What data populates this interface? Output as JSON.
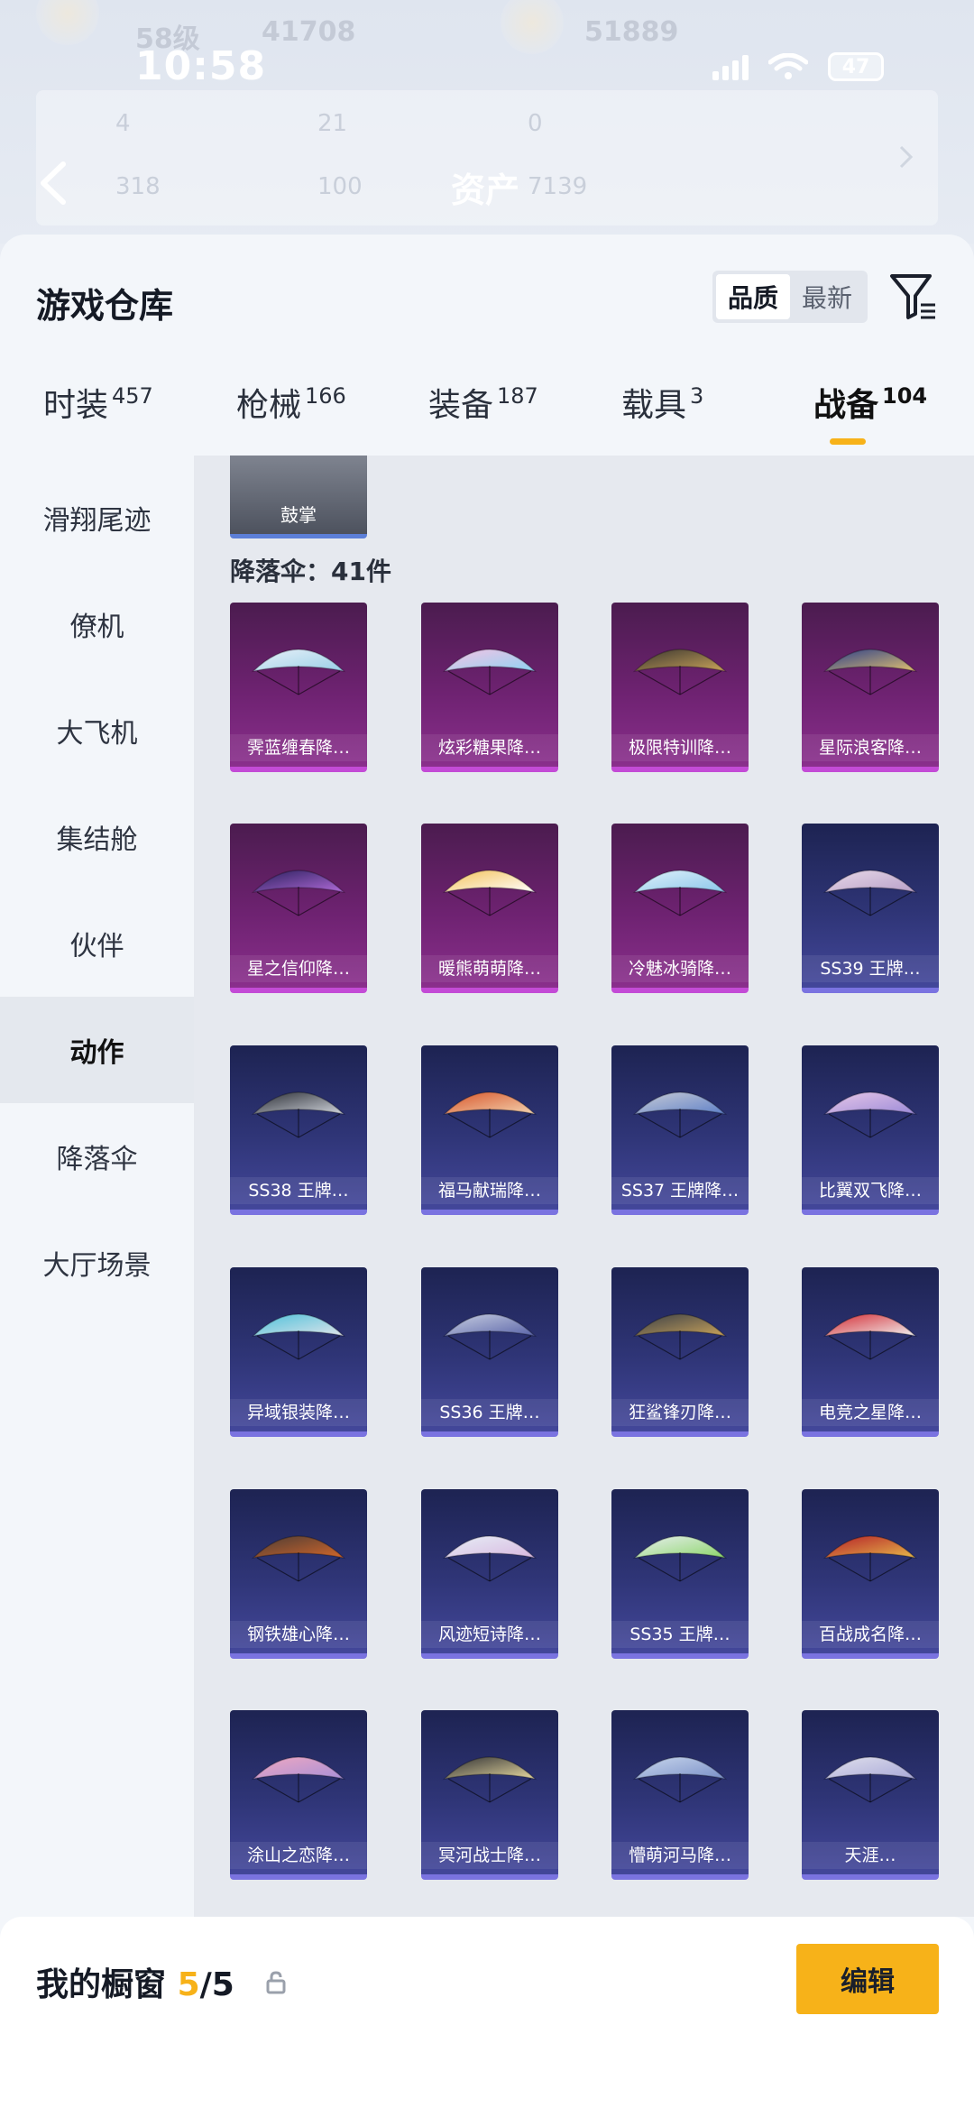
{
  "status_bar": {
    "time": "10:58",
    "battery": "47"
  },
  "background_header": {
    "left_level": "58级",
    "left_coins": "41708",
    "right_value": "51889",
    "stats_row1": [
      "4",
      "21",
      "0"
    ],
    "stats_row2": [
      "318",
      "100"
    ],
    "assets_label": "资产",
    "assets_value": "7139"
  },
  "sheet": {
    "title": "游戏仓库",
    "sort": {
      "quality": "品质",
      "newest": "最新"
    }
  },
  "tabs": [
    {
      "label": "时装",
      "count": "457"
    },
    {
      "label": "枪械",
      "count": "166"
    },
    {
      "label": "装备",
      "count": "187"
    },
    {
      "label": "载具",
      "count": "3"
    },
    {
      "label": "战备",
      "count": "104"
    }
  ],
  "sidebar": {
    "items": [
      {
        "label": "滑翔尾迹"
      },
      {
        "label": "僚机"
      },
      {
        "label": "大飞机"
      },
      {
        "label": "集结舱"
      },
      {
        "label": "伙伴"
      },
      {
        "label": "动作"
      },
      {
        "label": "降落伞"
      },
      {
        "label": "大厅场景"
      }
    ],
    "active_index": 5
  },
  "content": {
    "partial_item": "鼓掌",
    "section_label": "降落伞：41件",
    "items": [
      {
        "name": "霁蓝缠春降…",
        "rarity": "purple",
        "colors": [
          "#e8f0f8",
          "#9ad0e8"
        ]
      },
      {
        "name": "炫彩糖果降…",
        "rarity": "purple",
        "colors": [
          "#f6c2e4",
          "#8fd3f2"
        ]
      },
      {
        "name": "极限特训降…",
        "rarity": "purple",
        "colors": [
          "#3a3630",
          "#c9a35a"
        ]
      },
      {
        "name": "星际浪客降…",
        "rarity": "purple",
        "colors": [
          "#2a3d8a",
          "#e0c070"
        ]
      },
      {
        "name": "星之信仰降…",
        "rarity": "purple",
        "colors": [
          "#2a1f5c",
          "#b06ad8"
        ]
      },
      {
        "name": "暖熊萌萌降…",
        "rarity": "purple",
        "colors": [
          "#f3c25a",
          "#ffffff"
        ]
      },
      {
        "name": "冷魅冰骑降…",
        "rarity": "purple",
        "colors": [
          "#dff2fb",
          "#8bc6ea"
        ]
      },
      {
        "name": "SS39 王牌…",
        "rarity": "blue",
        "colors": [
          "#e7d8e8",
          "#b8a0c8"
        ]
      },
      {
        "name": "SS38 王牌…",
        "rarity": "blue",
        "colors": [
          "#2a2d34",
          "#d0d4dc"
        ]
      },
      {
        "name": "福马献瑞降…",
        "rarity": "blue",
        "colors": [
          "#d8552a",
          "#f2d3b0"
        ]
      },
      {
        "name": "SS37 王牌降…",
        "rarity": "blue",
        "colors": [
          "#c8ccd6",
          "#5f80c8"
        ]
      },
      {
        "name": "比翼双飞降…",
        "rarity": "blue",
        "colors": [
          "#e8c8e8",
          "#9b8ad8"
        ]
      },
      {
        "name": "异域银装降…",
        "rarity": "blue",
        "colors": [
          "#4cc0da",
          "#e0e4ea"
        ]
      },
      {
        "name": "SS36 王牌…",
        "rarity": "blue",
        "colors": [
          "#c8cfe2",
          "#5a64a8"
        ]
      },
      {
        "name": "狂鲨锋刃降…",
        "rarity": "blue",
        "colors": [
          "#3a3f47",
          "#c8a25a"
        ]
      },
      {
        "name": "电竞之星降…",
        "rarity": "blue",
        "colors": [
          "#d42a32",
          "#f0f0f0"
        ]
      },
      {
        "name": "钢铁雄心降…",
        "rarity": "blue",
        "colors": [
          "#4a3c36",
          "#d2662a"
        ]
      },
      {
        "name": "风迹短诗降…",
        "rarity": "blue",
        "colors": [
          "#e6eef6",
          "#d8b8e0"
        ]
      },
      {
        "name": "SS35 王牌…",
        "rarity": "blue",
        "colors": [
          "#e8eef0",
          "#8cd66a"
        ]
      },
      {
        "name": "百战成名降…",
        "rarity": "blue",
        "colors": [
          "#b41e28",
          "#e6b84a"
        ]
      },
      {
        "name": "涂山之恋降…",
        "rarity": "blue",
        "colors": [
          "#f0a8c0",
          "#a890d8"
        ]
      },
      {
        "name": "冥河战士降…",
        "rarity": "blue",
        "colors": [
          "#2e2f33",
          "#e6d8a0"
        ]
      },
      {
        "name": "懵萌河马降…",
        "rarity": "blue",
        "colors": [
          "#c8d6ec",
          "#7a90c8"
        ]
      },
      {
        "name": "天涯…",
        "rarity": "blue",
        "colors": [
          "#e0e0ec",
          "#a8a8d8"
        ]
      }
    ]
  },
  "bottom_bar": {
    "title_prefix": "我的橱窗",
    "count_current": "5",
    "count_total": "/5",
    "edit_label": "编辑"
  },
  "colors": {
    "accent": "#f7b219",
    "purple_rarity": "#c34bd6",
    "blue_rarity": "#7a73e0"
  }
}
